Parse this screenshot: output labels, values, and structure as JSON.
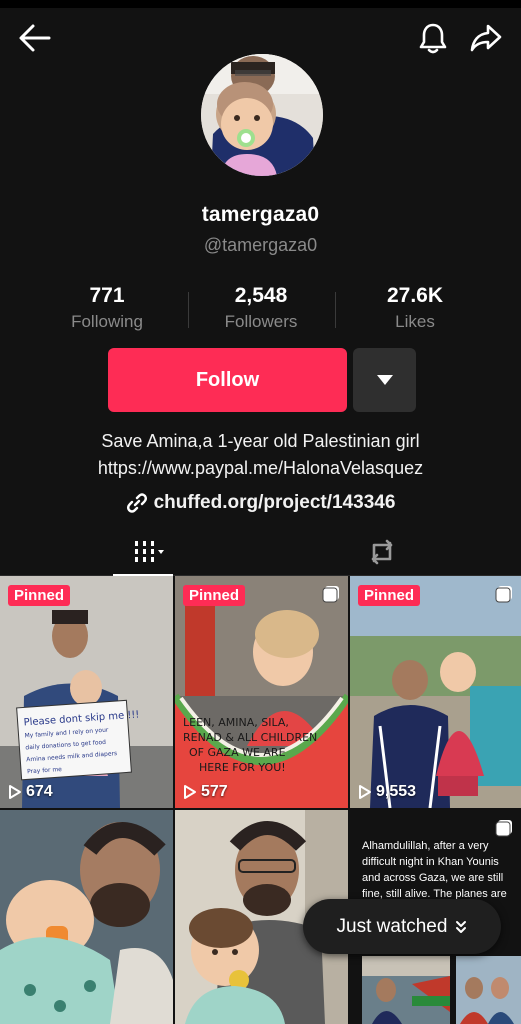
{
  "profile": {
    "username": "tamergaza0",
    "handle": "@tamergaza0",
    "stats": [
      {
        "value": "771",
        "label": "Following"
      },
      {
        "value": "2,548",
        "label": "Followers"
      },
      {
        "value": "27.6K",
        "label": "Likes"
      }
    ],
    "follow_label": "Follow",
    "bio_line1": "Save Amina,a 1-year old Palestinian girl",
    "bio_line2": "https://www.paypal.me/HalonaVelasquez",
    "link": "chuffed.org/project/143346"
  },
  "icons": {
    "back": "arrow-left-icon",
    "notifications": "bell-icon",
    "share": "share-arrow-icon",
    "dropdown": "caret-down-icon",
    "videos_tab": "grid-columns-icon",
    "reposts_tab": "repost-icon",
    "link": "chain-link-icon",
    "play": "play-outline-icon"
  },
  "colors": {
    "accent": "#fe2c55",
    "background": "#121212",
    "secondary_text": "#8a8a8a",
    "button_dark": "#2f2f2f"
  },
  "videos": [
    {
      "pinned_label": "Pinned",
      "views": "674",
      "sign_text": [
        "Please dont skip me !!!",
        "My family and I rely on your",
        "daily donations to get food",
        "Amina needs milk and diapers",
        "Pray for me"
      ]
    },
    {
      "pinned_label": "Pinned",
      "views": "577",
      "sign_text": [
        "LEEN, AMINA, SILA,",
        "RENAD & ALL CHILDREN",
        "OF GAZA WE ARE",
        "HERE FOR YOU!"
      ]
    },
    {
      "pinned_label": "Pinned",
      "views": "9,553"
    },
    {},
    {},
    {
      "caption": "Alhamdulillah, after a very difficult night in Khan Younis and across Gaza, we are still fine, still alive. The planes are still in the sky..."
    }
  ],
  "just_watched": {
    "label": "Just watched"
  }
}
